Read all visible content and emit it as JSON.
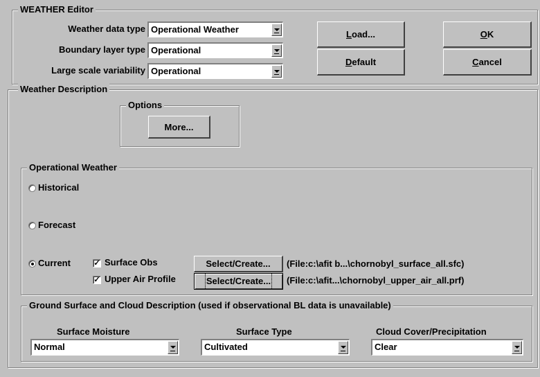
{
  "editor": {
    "title": "WEATHER Editor",
    "weather_data_type": {
      "label": "Weather data type",
      "value": "Operational Weather"
    },
    "boundary_layer_type": {
      "label": "Boundary layer type",
      "value": "Operational"
    },
    "large_scale_variability": {
      "label": "Large scale variability",
      "value": "Operational"
    },
    "buttons": {
      "load": {
        "pre": "",
        "key": "L",
        "post": "oad..."
      },
      "default": {
        "pre": "",
        "key": "D",
        "post": "efault"
      },
      "ok": {
        "pre": "",
        "key": "O",
        "post": "K"
      },
      "cancel": {
        "pre": "",
        "key": "C",
        "post": "ancel"
      }
    }
  },
  "weather_description": {
    "title": "Weather Description",
    "options": {
      "title": "Options",
      "more_button": "More..."
    },
    "operational": {
      "title": "Operational Weather",
      "historical": "Historical",
      "forecast": "Forecast",
      "current": "Current",
      "selected": "Current",
      "surface_obs": {
        "label": "Surface Obs",
        "checked": true,
        "button": "Select/Create...",
        "file": "(File:c:\\afit b...\\chornobyl_surface_all.sfc)"
      },
      "upper_air": {
        "label": "Upper Air Profile",
        "checked": true,
        "button": "Select/Create...",
        "file": "(File:c:\\afit...\\chornobyl_upper_air_all.prf)"
      }
    },
    "ground": {
      "title": "Ground Surface and Cloud Description (used if observational BL data is unavailable)",
      "surface_moisture": {
        "label": "Surface Moisture",
        "value": "Normal"
      },
      "surface_type": {
        "label": "Surface Type",
        "value": "Cultivated"
      },
      "cloud_cover": {
        "label": "Cloud Cover/Precipitation",
        "value": "Clear"
      }
    }
  }
}
